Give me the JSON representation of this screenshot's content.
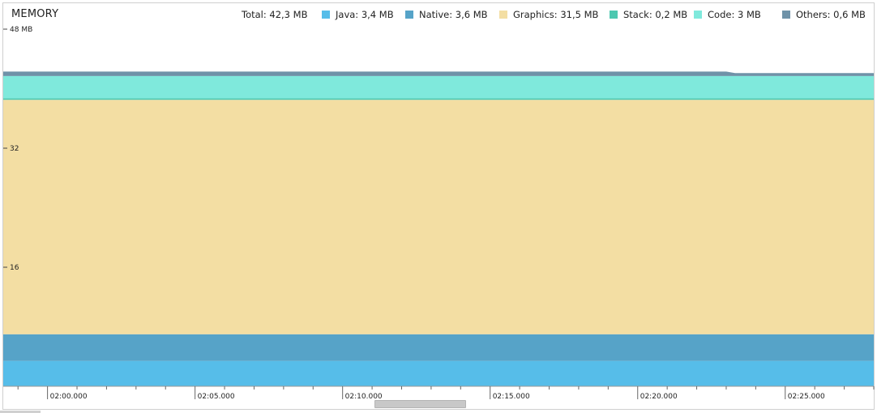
{
  "title": "MEMORY",
  "legend": {
    "total": "Total: 42,3 MB",
    "items": [
      {
        "key": "java",
        "label": "Java: 3,4 MB",
        "color": "#56bde9"
      },
      {
        "key": "native",
        "label": "Native: 3,6 MB",
        "color": "#56a3c8"
      },
      {
        "key": "graphics",
        "label": "Graphics: 31,5 MB",
        "color": "#f3dea3"
      },
      {
        "key": "stack",
        "label": "Stack: 0,2 MB",
        "color": "#4dc8b0"
      },
      {
        "key": "code",
        "label": "Code: 3 MB",
        "color": "#7fe9dc"
      },
      {
        "key": "others",
        "label": "Others: 0,6 MB",
        "color": "#6f92a8"
      }
    ]
  },
  "chart_data": {
    "type": "area",
    "stacked": true,
    "y_unit": "MB",
    "y_ticks": [
      {
        "value": 48,
        "label": "48 MB"
      },
      {
        "value": 32,
        "label": "32"
      },
      {
        "value": 16,
        "label": "16"
      }
    ],
    "x_ticks": [
      "02:00.000",
      "02:05.000",
      "02:10.000",
      "02:15.000",
      "02:20.000",
      "02:25.000"
    ],
    "x_range": [
      "01:58.500",
      "02:28.000"
    ],
    "ylim": [
      0,
      48
    ],
    "x": [
      "01:58.500",
      "02:23.000",
      "02:23.300",
      "02:28.000"
    ],
    "series": [
      {
        "name": "Java",
        "values": [
          3.4,
          3.4,
          3.4,
          3.4
        ]
      },
      {
        "name": "Native",
        "values": [
          3.6,
          3.6,
          3.6,
          3.6
        ]
      },
      {
        "name": "Graphics",
        "values": [
          31.5,
          31.5,
          31.5,
          31.5
        ]
      },
      {
        "name": "Stack",
        "values": [
          0.2,
          0.2,
          0.2,
          0.2
        ]
      },
      {
        "name": "Code",
        "values": [
          3.0,
          3.0,
          3.0,
          3.0
        ]
      },
      {
        "name": "Others",
        "values": [
          0.6,
          0.6,
          0.4,
          0.4
        ]
      }
    ],
    "grid": false,
    "legend_position": "top"
  }
}
